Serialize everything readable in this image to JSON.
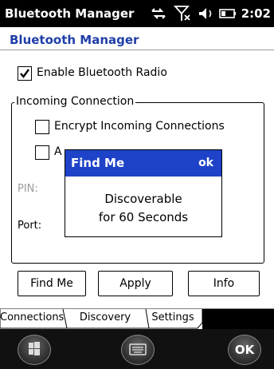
{
  "statusbar": {
    "app_title": "Bluetooth Manager",
    "clock": "2:02",
    "icons": [
      "data-sync-icon",
      "signal-off-icon",
      "speaker-icon",
      "battery-icon"
    ]
  },
  "header": {
    "title": "Bluetooth Manager"
  },
  "settings": {
    "enable_radio": {
      "label": "Enable Bluetooth Radio",
      "checked": true
    },
    "incoming_group_label": "Incoming Connection",
    "encrypt": {
      "label": "Encrypt Incoming Connections",
      "checked": false
    },
    "auth": {
      "label": "A",
      "checked": false
    },
    "pin_label": "PIN:",
    "port_label": "Port:"
  },
  "popup": {
    "title": "Find Me",
    "ok_label": "ok",
    "message_line1": "Discoverable",
    "message_line2": "for 60 Seconds"
  },
  "buttons": {
    "find_me": "Find Me",
    "apply": "Apply",
    "info": "Info"
  },
  "tabs": [
    {
      "label": "Connections",
      "active": false
    },
    {
      "label": "Discovery",
      "active": false
    },
    {
      "label": "Settings",
      "active": true
    }
  ],
  "softkeys": {
    "ok_label": "OK"
  },
  "colors": {
    "accent": "#1e43c8",
    "header_text": "#1f3ea8",
    "titlebar": "#000000"
  }
}
